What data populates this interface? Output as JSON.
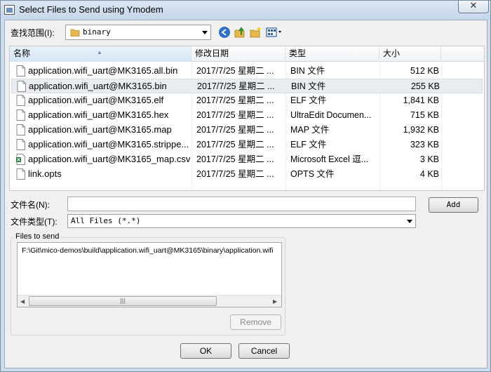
{
  "window": {
    "title": "Select Files to Send using Ymodem",
    "close_symbol": "✕"
  },
  "lookin": {
    "label": "查找范围(I):",
    "value": "binary"
  },
  "toolbar_icons": [
    "back-icon",
    "up-folder-icon",
    "new-folder-icon",
    "view-menu-icon"
  ],
  "list": {
    "headers": {
      "name": "名称",
      "date": "修改日期",
      "type": "类型",
      "size": "大小"
    },
    "rows": [
      {
        "name": "application.wifi_uart@MK3165.all.bin",
        "date": "2017/7/25 星期二 ...",
        "type": "BIN 文件",
        "size": "512 KB",
        "icon": "file-icon"
      },
      {
        "name": "application.wifi_uart@MK3165.bin",
        "date": "2017/7/25 星期二 ...",
        "type": "BIN 文件",
        "size": "255 KB",
        "icon": "file-icon",
        "selected": true
      },
      {
        "name": "application.wifi_uart@MK3165.elf",
        "date": "2017/7/25 星期二 ...",
        "type": "ELF 文件",
        "size": "1,841 KB",
        "icon": "file-icon"
      },
      {
        "name": "application.wifi_uart@MK3165.hex",
        "date": "2017/7/25 星期二 ...",
        "type": "UltraEdit Documen...",
        "size": "715 KB",
        "icon": "file-icon"
      },
      {
        "name": "application.wifi_uart@MK3165.map",
        "date": "2017/7/25 星期二 ...",
        "type": "MAP 文件",
        "size": "1,932 KB",
        "icon": "file-icon"
      },
      {
        "name": "application.wifi_uart@MK3165.strippe...",
        "date": "2017/7/25 星期二 ...",
        "type": "ELF 文件",
        "size": "323 KB",
        "icon": "file-icon"
      },
      {
        "name": "application.wifi_uart@MK3165_map.csv",
        "date": "2017/7/25 星期二 ...",
        "type": "Microsoft Excel 逗...",
        "size": "3 KB",
        "icon": "excel-icon"
      },
      {
        "name": "link.opts",
        "date": "2017/7/25 星期二 ...",
        "type": "OPTS 文件",
        "size": "4 KB",
        "icon": "file-icon"
      }
    ]
  },
  "filename": {
    "label": "文件名(N):",
    "value": ""
  },
  "filetype": {
    "label": "文件类型(T):",
    "value": "All Files (*.*)"
  },
  "add_label": "Add",
  "files_to_send": {
    "title": "Files to send",
    "items": [
      "F:\\Git\\mico-demos\\build\\application.wifi_uart@MK3165\\binary\\application.wifi"
    ],
    "remove_label": "Remove"
  },
  "ok_label": "OK",
  "cancel_label": "Cancel",
  "colors": {
    "selected_row": "#e9ecf0",
    "folder": "#e8b94a",
    "back_button": "#2d6fc8",
    "excel": "#1d7a3a"
  }
}
